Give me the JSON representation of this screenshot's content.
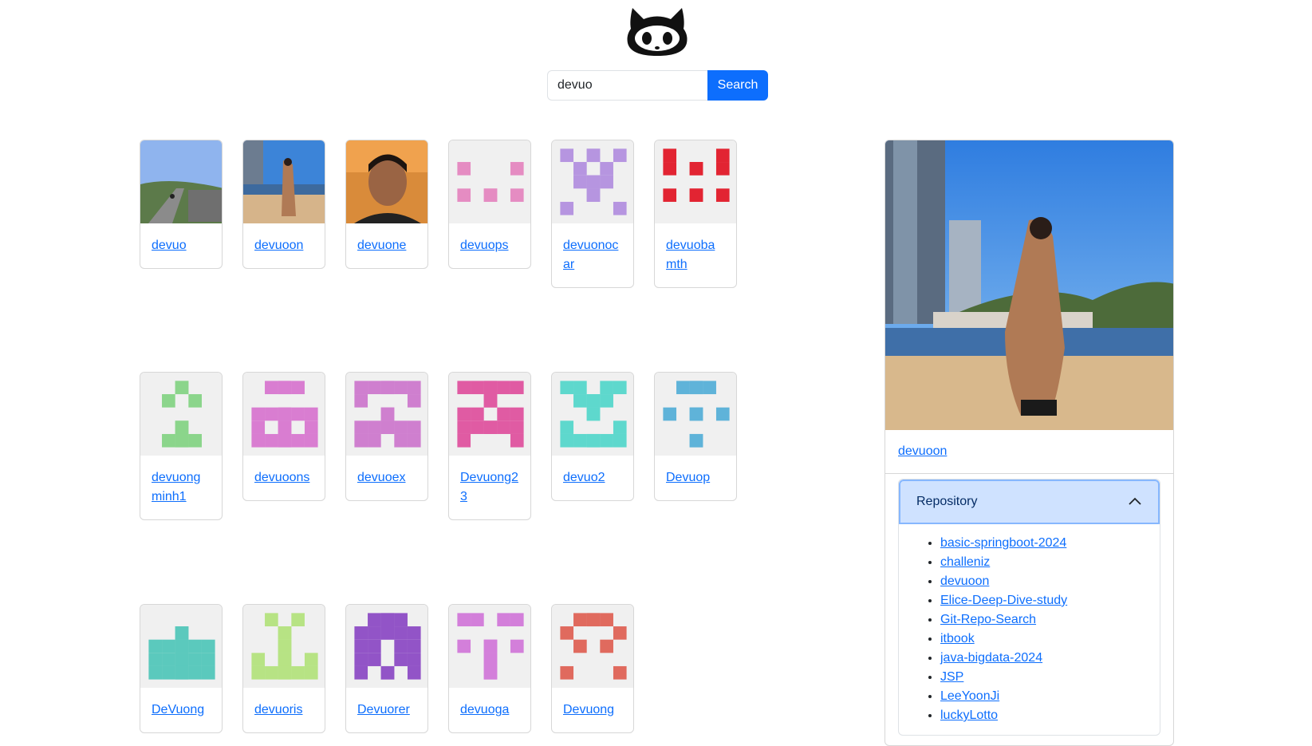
{
  "search": {
    "value": "devuo",
    "button_label": "Search"
  },
  "results": [
    {
      "login": "devuo",
      "avatar": "photo-road"
    },
    {
      "login": "devuoon",
      "avatar": "photo-beach"
    },
    {
      "login": "devuone",
      "avatar": "photo-face"
    },
    {
      "login": "devuops",
      "avatar": "identicon",
      "color": "#e58cc2"
    },
    {
      "login": "devuonocar",
      "avatar": "identicon",
      "color": "#b695e0"
    },
    {
      "login": "devuobamth",
      "avatar": "identicon",
      "color": "#e22432"
    },
    {
      "login": "devuongminh1",
      "avatar": "identicon",
      "color": "#8bd58b"
    },
    {
      "login": "devuoons",
      "avatar": "identicon",
      "color": "#d97dd1"
    },
    {
      "login": "devuoex",
      "avatar": "identicon",
      "color": "#cf7fcf"
    },
    {
      "login": "Devuong23",
      "avatar": "identicon",
      "color": "#e05ba3"
    },
    {
      "login": "devuo2",
      "avatar": "identicon",
      "color": "#5ed8cd"
    },
    {
      "login": "Devuop",
      "avatar": "identicon",
      "color": "#5fb3d9"
    },
    {
      "login": "DeVuong",
      "avatar": "identicon",
      "color": "#5bc9bd"
    },
    {
      "login": "devuoris",
      "avatar": "identicon",
      "color": "#b7e384"
    },
    {
      "login": "Devuorer",
      "avatar": "identicon",
      "color": "#9254c7"
    },
    {
      "login": "devuoga",
      "avatar": "identicon",
      "color": "#d37fda"
    },
    {
      "login": "Devuong",
      "avatar": "identicon",
      "color": "#e06a5e"
    }
  ],
  "selected_user": {
    "login": "devuoon",
    "accordion_title": "Repository",
    "repositories": [
      "basic-springboot-2024",
      "challeniz",
      "devuoon",
      "Elice-Deep-Dive-study",
      "Git-Repo-Search",
      "itbook",
      "java-bigdata-2024",
      "JSP",
      "LeeYoonJi",
      "luckyLotto"
    ]
  },
  "colors": {
    "primary": "#0d6efd",
    "accordion_header": "#cfe2ff",
    "card_border": "#d7d7d7",
    "identicon_bg": "#f0f0f0"
  }
}
